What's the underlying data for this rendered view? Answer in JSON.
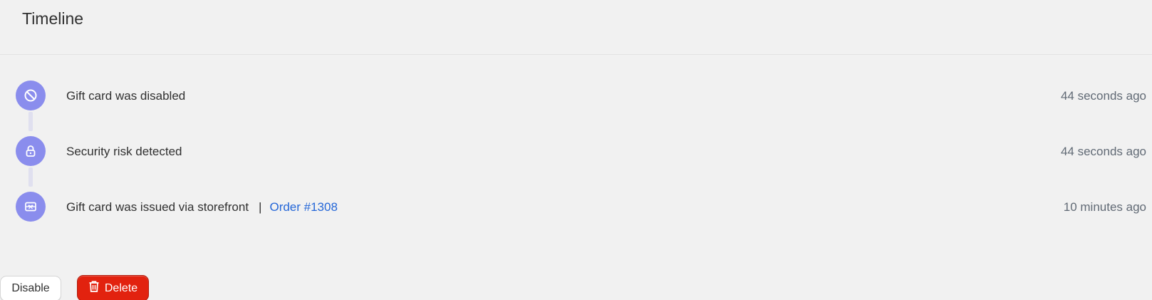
{
  "card": {
    "title": "Timeline"
  },
  "timeline": {
    "events": [
      {
        "icon": "disabled-icon",
        "text": "Gift card was disabled",
        "time": "44 seconds ago"
      },
      {
        "icon": "lock-icon",
        "text": "Security risk detected",
        "time": "44 seconds ago"
      },
      {
        "icon": "gift-card-icon",
        "text": "Gift card was issued via storefront",
        "separator": "|",
        "link": "Order #1308",
        "time": "10 minutes ago"
      }
    ]
  },
  "actions": {
    "disable_label": "Disable",
    "delete_label": "Delete"
  },
  "colors": {
    "background": "#f1f1f1",
    "timeline_dot": "#8a8ded",
    "connector": "#e0e0ef",
    "link": "#2567d8",
    "danger": "#e2220f",
    "muted_text": "#616a75"
  }
}
